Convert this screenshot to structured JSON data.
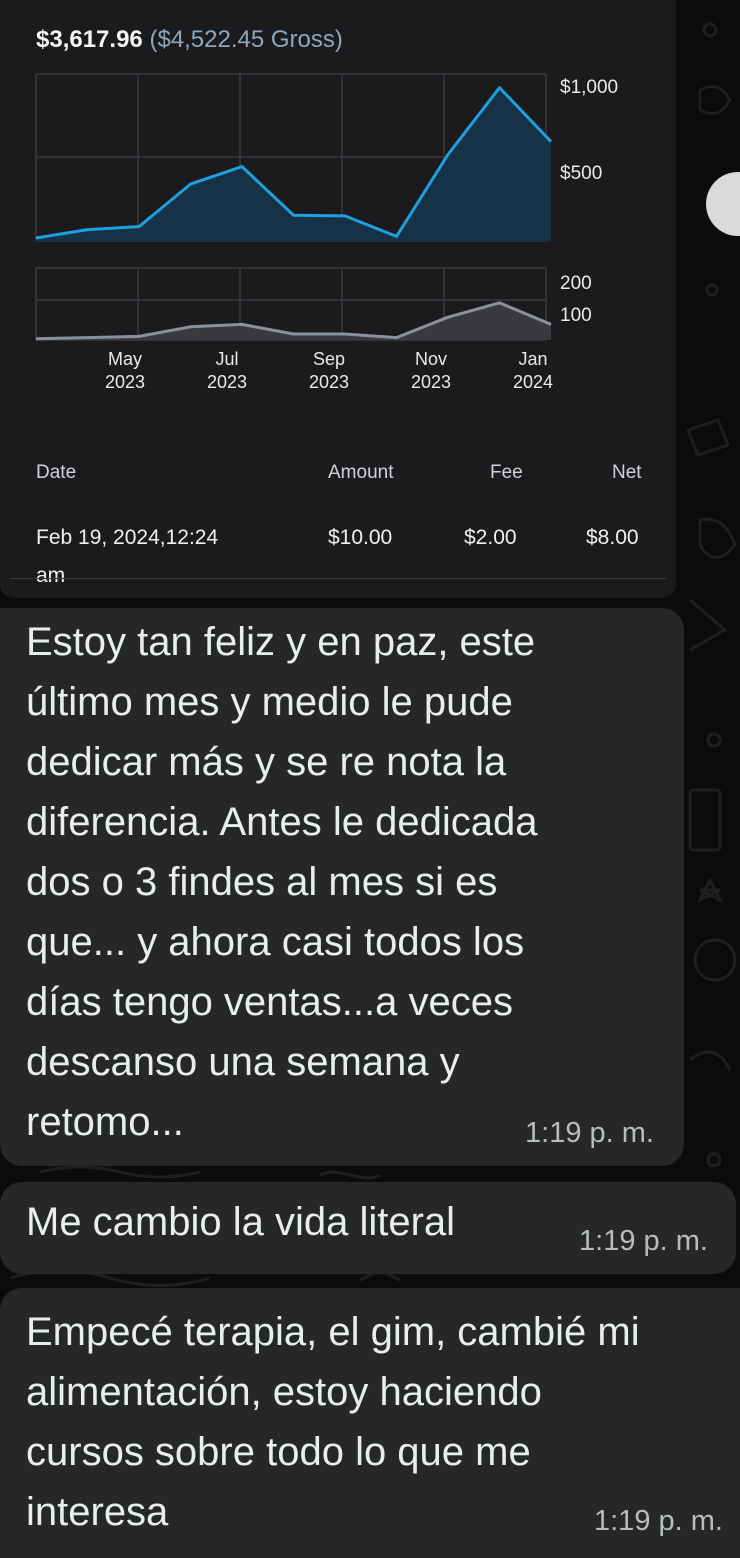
{
  "earnings": {
    "net": "$3,617.96",
    "gross": "($4,522.45 Gross)"
  },
  "chart_data": [
    {
      "type": "area",
      "title": "",
      "x": [
        "2023-04",
        "2023-05",
        "2023-06",
        "2023-07",
        "2023-08",
        "2023-09",
        "2023-10",
        "2023-11",
        "2023-12",
        "2024-01",
        "2024-02"
      ],
      "x_tick_labels": [
        {
          "month": "May",
          "year": "2023"
        },
        {
          "month": "Jul",
          "year": "2023"
        },
        {
          "month": "Sep",
          "year": "2023"
        },
        {
          "month": "Nov",
          "year": "2023"
        },
        {
          "month": "Jan",
          "year": "2024"
        }
      ],
      "y_tick_labels": [
        "$1,000",
        "$500"
      ],
      "ylim": [
        0,
        1100
      ],
      "series": [
        {
          "values": [
            20,
            75,
            95,
            375,
            490,
            170,
            165,
            30,
            570,
            1010,
            655
          ]
        }
      ],
      "colors": {
        "line": "#1e9fe0",
        "fill": "#163246"
      }
    },
    {
      "type": "area",
      "title": "",
      "x": [
        "2023-04",
        "2023-05",
        "2023-06",
        "2023-07",
        "2023-08",
        "2023-09",
        "2023-10",
        "2023-11",
        "2023-12",
        "2024-01",
        "2024-02"
      ],
      "y_tick_labels": [
        "200",
        "100"
      ],
      "ylim": [
        0,
        300
      ],
      "series": [
        {
          "values": [
            5,
            10,
            15,
            55,
            65,
            25,
            25,
            10,
            95,
            155,
            65
          ]
        }
      ],
      "colors": {
        "line": "#8a9199",
        "fill": "#3a3a3e"
      }
    }
  ],
  "table": {
    "headers": {
      "date": "Date",
      "amount": "Amount",
      "fee": "Fee",
      "net": "Net"
    },
    "rows": [
      {
        "date": "Feb 19, 2024,12:24",
        "date_suffix": "am",
        "amount": "$10.00",
        "fee": "$2.00",
        "net": "$8.00"
      }
    ]
  },
  "messages": [
    {
      "lines": [
        "Estoy tan feliz y en paz,  este",
        "último mes y medio le pude",
        "dedicar más y se re nota la",
        "diferencia. Antes le dedicada",
        "dos o 3 findes al mes si es",
        "que... y ahora casi todos los",
        "días tengo ventas...a veces",
        "descanso una semana y",
        "retomo..."
      ],
      "time": "1:19 p. m."
    },
    {
      "lines": [
        "Me cambio la vida literal"
      ],
      "time": "1:19 p. m."
    },
    {
      "lines": [
        "Empecé terapia, el gim, cambié mi",
        "alimentación, estoy haciendo",
        "cursos sobre todo lo que me",
        "interesa"
      ],
      "time": "1:19 p. m."
    }
  ]
}
